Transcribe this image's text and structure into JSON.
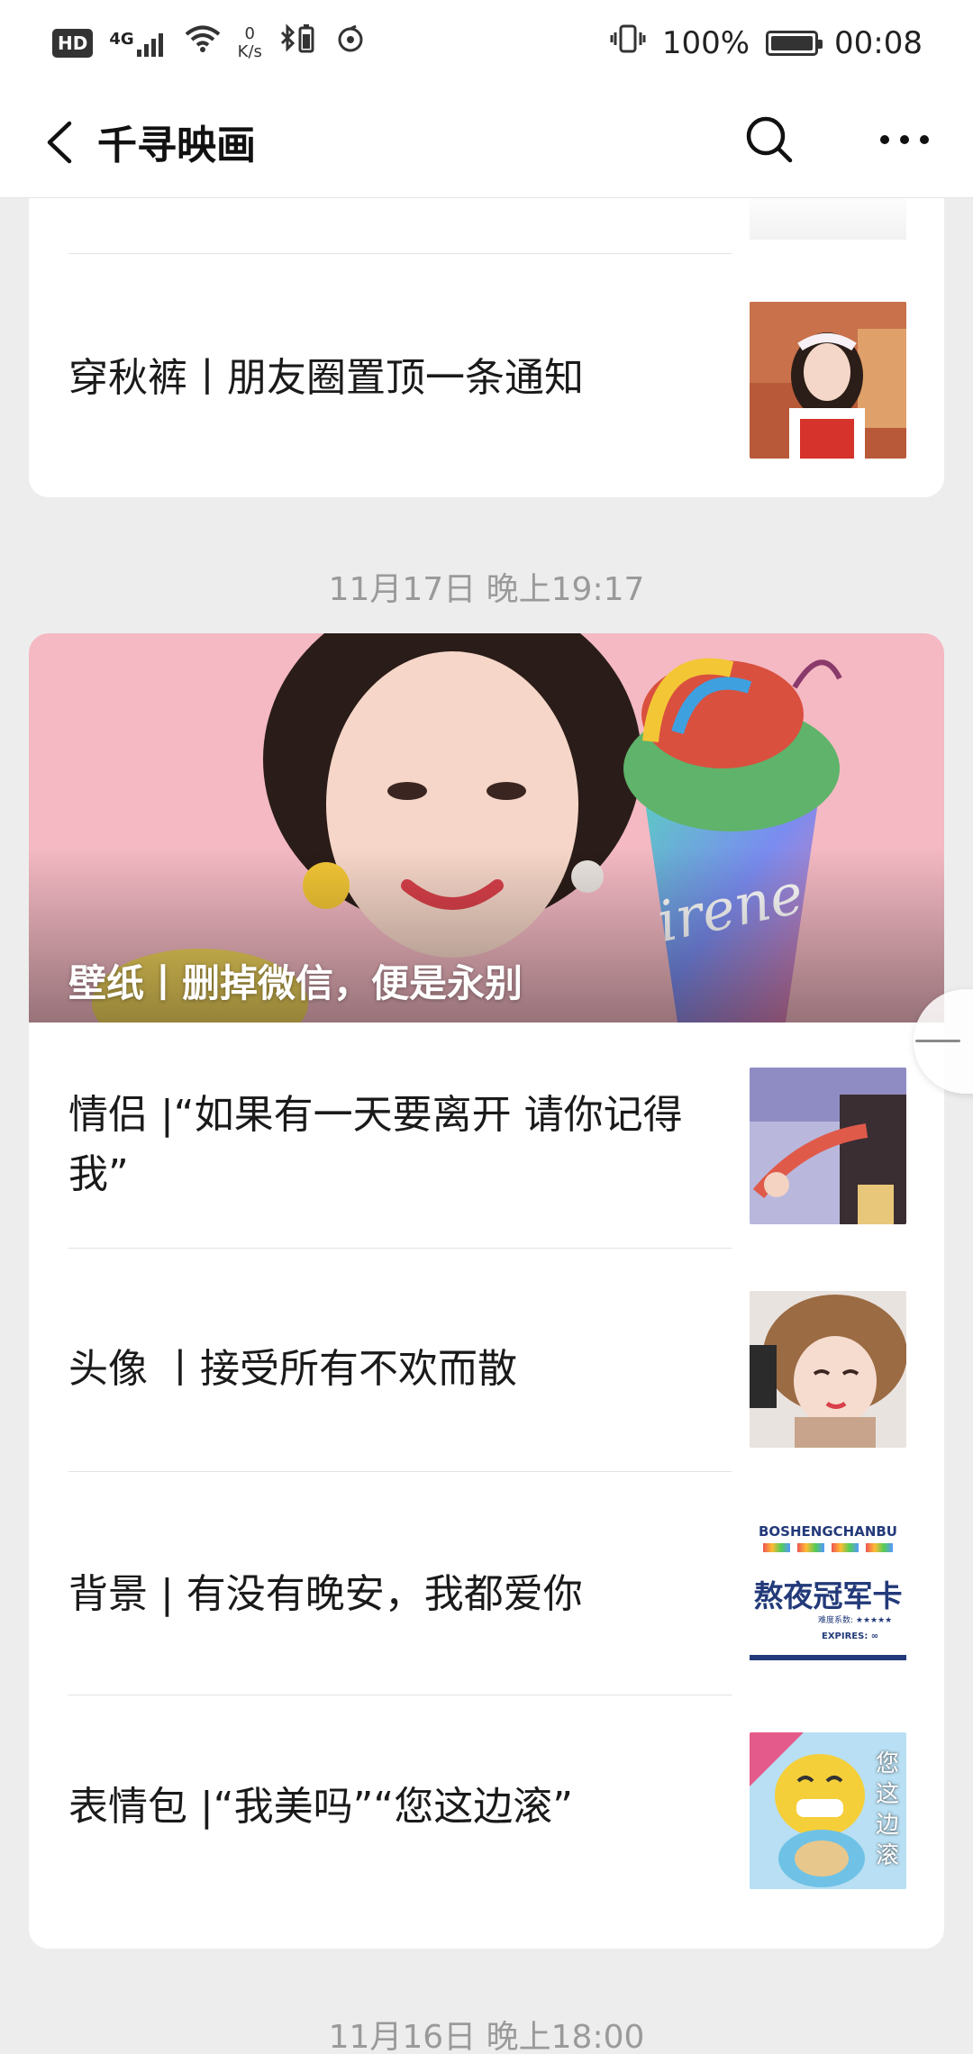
{
  "status_bar": {
    "left_indicators": [
      "HD",
      "4G"
    ],
    "speed_value": "0",
    "speed_unit": "K/s",
    "battery_percent": "100%",
    "time": "00:08"
  },
  "nav": {
    "title": "千寻映画"
  },
  "feed": {
    "top_card": {
      "items": [
        {
          "title": "穿秋裤丨朋友圈置顶一条通知",
          "thumb": "portrait-girl-headband"
        }
      ]
    },
    "groups": [
      {
        "timestamp": "11月17日 晚上19:17",
        "cover": {
          "title": "壁纸丨删掉微信，便是永别",
          "cover_text": "irene"
        },
        "items": [
          {
            "title": "情侣 |“如果有一天要离开 请你记得我”",
            "thumb": "couple-holding-hands"
          },
          {
            "title": "头像 丨接受所有不欢而散",
            "thumb": "girl-fur-hat"
          },
          {
            "title": "背景 | 有没有晚安，我都爱你",
            "thumb": "award-card",
            "thumb_text": {
              "line1": "BOSHENGCHANBU",
              "line2": "熬夜冠军卡",
              "line3": "难度系数: ★★★★★",
              "line4": "EXPIRES: ∞"
            }
          },
          {
            "title": "表情包 |“我美吗”“您这边滚”",
            "thumb": "squirtle-meme",
            "thumb_text": "您这边滚"
          }
        ]
      },
      {
        "timestamp": "11月16日 晚上18:00"
      }
    ]
  }
}
